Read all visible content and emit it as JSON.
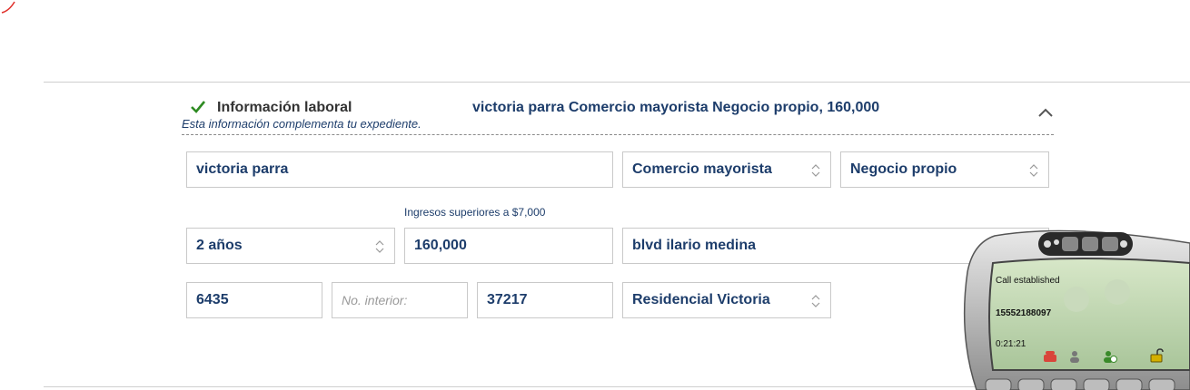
{
  "section": {
    "title": "Información laboral",
    "subtitle": "Esta información complementa tu expediente.",
    "summary": "victoria parra Comercio mayorista Negocio propio, 160,000"
  },
  "fields": {
    "company_name": "victoria parra",
    "industry": "Comercio mayorista",
    "employment_type": "Negocio propio",
    "seniority": "2 años",
    "income": "160,000",
    "income_hint": "Ingresos superiores a $7,000",
    "street": "blvd ilario medina",
    "ext_number": "6435",
    "int_number_placeholder": "No. interior:",
    "zip_code": "37217",
    "neighborhood": "Residencial Victoria"
  },
  "softphone": {
    "status": "Call established",
    "number": "15552188097",
    "timer": "0:21:21"
  },
  "colors": {
    "accent_text": "#1d3d6b",
    "check": "#2e8b22",
    "border": "#c9c9c9"
  }
}
